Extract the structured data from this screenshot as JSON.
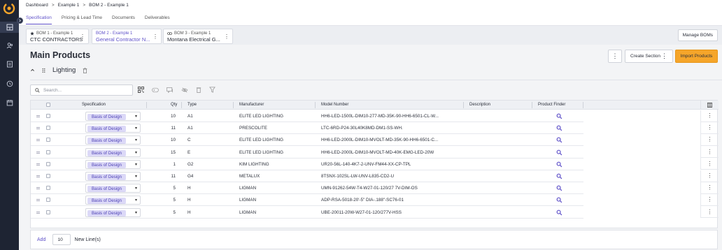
{
  "breadcrumbs": [
    "Dashboard",
    "Example 1",
    "BOM 2 - Example 1"
  ],
  "breadcrumb_separator": ">",
  "tabs": [
    {
      "label": "Specification",
      "active": true
    },
    {
      "label": "Pricing & Lead Time",
      "active": false
    },
    {
      "label": "Documents",
      "active": false
    },
    {
      "label": "Deliverables",
      "active": false
    }
  ],
  "boms": [
    {
      "small": "BOM 1 - Example 1",
      "big": "CTC CONTRACTORS",
      "icon": "star-icon",
      "active": false
    },
    {
      "small": "BOM 2 - Example 1",
      "big": "General Contractor N...",
      "icon": "",
      "active": true
    },
    {
      "small": "BOM 3 - Example 1",
      "big": "Montana Electrical G...",
      "icon": "link-icon",
      "active": false
    }
  ],
  "manage_boms_label": "Manage BOMs",
  "page_title": "Main Products",
  "create_section_label": "Create Section",
  "import_products_label": "Import Products",
  "section_name": "Lighting",
  "search_placeholder": "Search...",
  "columns": {
    "specification": "Specification",
    "qty": "Qty",
    "type": "Type",
    "manufacturer": "Manufacturer",
    "model_number": "Model Number",
    "description": "Description",
    "product_finder": "Product Finder"
  },
  "rows": [
    {
      "spec": "Basis of Design",
      "qty": "10",
      "type": "A1",
      "manufacturer": "ELITE LED LIGHTING",
      "model": "HH6-LED-1500L-DIM10-277-MD-35K-90-HH6-6501-CL-W...",
      "description": ""
    },
    {
      "spec": "Basis of Design",
      "qty": "11",
      "type": "A1",
      "manufacturer": "PRESCOLITE",
      "model": "LTC-6RD-P24-30L40K8MD-DM1-SS-WH.",
      "description": ""
    },
    {
      "spec": "Basis of Design",
      "qty": "10",
      "type": "C",
      "manufacturer": "ELITE LED LIGHTING",
      "model": "HH6-LED-2000L-DIM10-MVOLT-MD-35K-90-HH6-6501-C...",
      "description": ""
    },
    {
      "spec": "Basis of Design",
      "qty": "15",
      "type": "E",
      "manufacturer": "ELITE LED LIGHTING",
      "model": "HH6-LED-2000L-DIM10-MVOLT-MD-40K-EMG-LED-20W",
      "description": ""
    },
    {
      "spec": "Basis of Design",
      "qty": "1",
      "type": "G2",
      "manufacturer": "KIM LIGHTING",
      "model": "UR20-56L-140-4K7-2-UNV-FM44-XX-CP-TPL",
      "description": ""
    },
    {
      "spec": "Basis of Design",
      "qty": "11",
      "type": "G4",
      "manufacturer": "METALUX",
      "model": "8TSNX-102SL-LW-UNV-L835-CD2-U",
      "description": ""
    },
    {
      "spec": "Basis of Design",
      "qty": "5",
      "type": "H",
      "manufacturer": "LIGMAN",
      "model": "UMN-91262-54W-T4-W27-01-120/27 7V-DIM-OS",
      "description": ""
    },
    {
      "spec": "Basis of Design",
      "qty": "5",
      "type": "H",
      "manufacturer": "LIGMAN",
      "model": "ADP-RSA-5018-20'-5\" DIA-.188\"-SC76-01",
      "description": ""
    },
    {
      "spec": "Basis of Design",
      "qty": "5",
      "type": "H",
      "manufacturer": "LIGMAN",
      "model": "UBE-20011-20W-W27-01-120/277V-HSS",
      "description": ""
    }
  ],
  "footer": {
    "add_label": "Add",
    "count_value": "10",
    "new_lines_label": "New Line(s)"
  },
  "colors": {
    "accent": "#5f51c9",
    "import_button": "#f5a52a",
    "sidebar": "#1e2433",
    "pill": "#dcd9f7"
  }
}
